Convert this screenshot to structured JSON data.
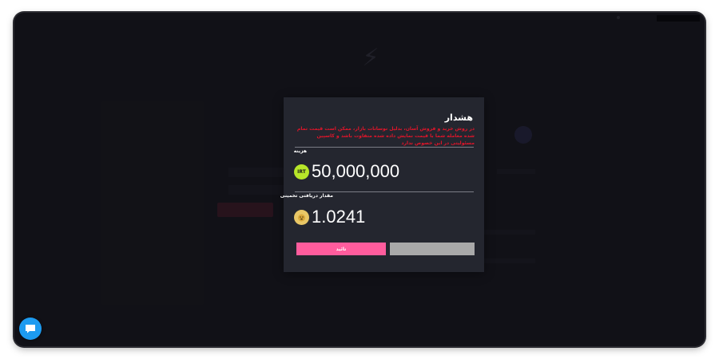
{
  "modal": {
    "title": "هشدار",
    "warning": "در روش خرید و فروش آسان، بدلیل نوسانات بازار، ممکن است قیمت تمام شده معامله شما با قیمت نمایش داده شده متفاوت باشد و کاسپین مسئولیتی در این خصوص ندارد",
    "cost_label": "هزینه",
    "cost_currency": "IRT",
    "cost_amount": "50,000,000",
    "estimated_label": "مقدار دریافتی تخمینی",
    "estimated_amount": "1.0241",
    "confirm_label": "تائید",
    "cancel_label": ""
  },
  "icons": {
    "cost_coin": "irt-coin-icon",
    "estimated_coin": "doge-coin-icon",
    "chat": "chat-icon"
  },
  "colors": {
    "accent_pink": "#ff5c9d",
    "warning_red": "#e0152a",
    "irt_green": "#b7e629",
    "chat_blue": "#1d9bf0"
  }
}
